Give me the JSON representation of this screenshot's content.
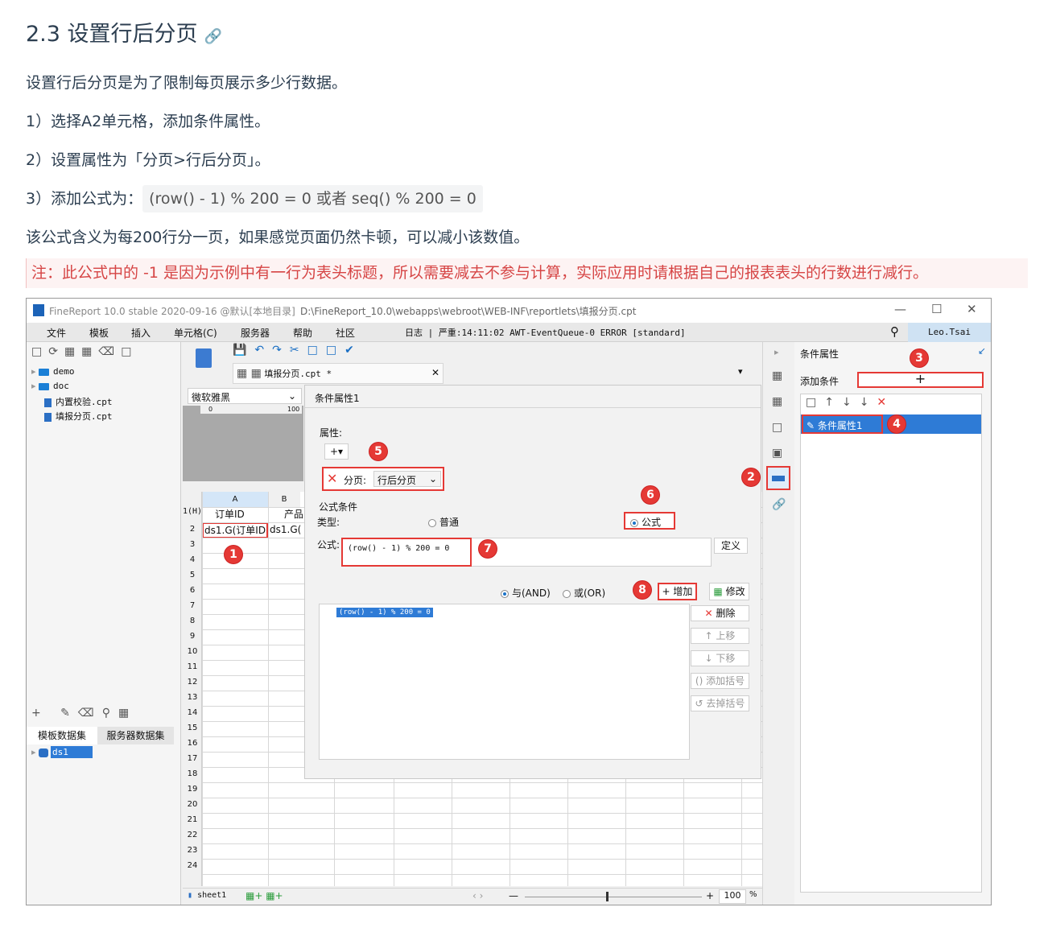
{
  "doc": {
    "heading": "2.3 设置行后分页",
    "p1": "设置行后分页是为了限制每页展示多少行数据。",
    "step1": "1）选择A2单元格，添加条件属性。",
    "step2": "2）设置属性为「分页>行后分页」。",
    "step3_label": "3）添加公式为：",
    "step3_code": "(row() - 1) % 200 = 0 或者 seq() % 200 = 0",
    "p_meaning": "该公式含义为每200行分一页，如果感觉页面仍然卡顿，可以减小该数值。",
    "note": "注：此公式中的 -1 是因为示例中有一行为表头标题，所以需要减去不参与计算，实际应用时请根据自己的报表表头的行数进行减行。"
  },
  "app": {
    "title": "FineReport 10.0 stable 2020-09-16 @默认[本地目录]",
    "path": "D:\\FineReport_10.0\\webapps\\webroot\\WEB-INF\\reportlets\\填报分页.cpt",
    "menu": [
      "文件",
      "模板",
      "插入",
      "单元格(C)",
      "服务器",
      "帮助",
      "社区"
    ],
    "log": "日志 | 严重:14:11:02 AWT-EventQueue-0 ERROR [standard]",
    "user": "Leo.Tsai"
  },
  "tree": {
    "items": [
      "demo",
      "doc",
      "内置校验.cpt",
      "填报分页.cpt"
    ]
  },
  "dataset": {
    "tabs": [
      "模板数据集",
      "服务器数据集"
    ],
    "item": "ds1"
  },
  "editor": {
    "tab": "填报分页.cpt *",
    "font": "微软雅黑",
    "ruler": [
      "0",
      "100"
    ],
    "columns": [
      "A",
      "B"
    ],
    "header_row": "1(H)",
    "rows": [
      "2",
      "3",
      "4",
      "5",
      "6",
      "7",
      "8",
      "9",
      "10",
      "11",
      "12",
      "13",
      "14",
      "15",
      "16",
      "17",
      "18",
      "19",
      "20",
      "21",
      "22",
      "23",
      "24"
    ],
    "cell_a1": "订单ID",
    "cell_b1": "产品",
    "cell_a2": "ds1.G(订单ID)",
    "cell_b2": "ds1.G(",
    "sheet": "sheet1",
    "zoom": "100",
    "zoom_unit": "%"
  },
  "dialog": {
    "title": "条件属性1",
    "attr_label": "属性:",
    "paging_label": "分页:",
    "paging_value": "行后分页",
    "cond_label": "公式条件",
    "type_label": "类型:",
    "type_normal": "普通",
    "type_formula": "公式",
    "formula_label": "公式:",
    "formula": "(row() - 1) % 200 = 0",
    "define": "定义",
    "and": "与(AND)",
    "or": "或(OR)",
    "add": "增加",
    "modify": "修改",
    "delete": "删除",
    "up": "上移",
    "down": "下移",
    "add_bracket": "添加括号",
    "remove_bracket": "去掉括号",
    "list_item": "(row() - 1) % 200 = 0"
  },
  "right": {
    "title": "条件属性",
    "add_cond": "添加条件",
    "item": "条件属性1"
  },
  "badges": [
    "1",
    "2",
    "3",
    "4",
    "5",
    "6",
    "7",
    "8"
  ]
}
